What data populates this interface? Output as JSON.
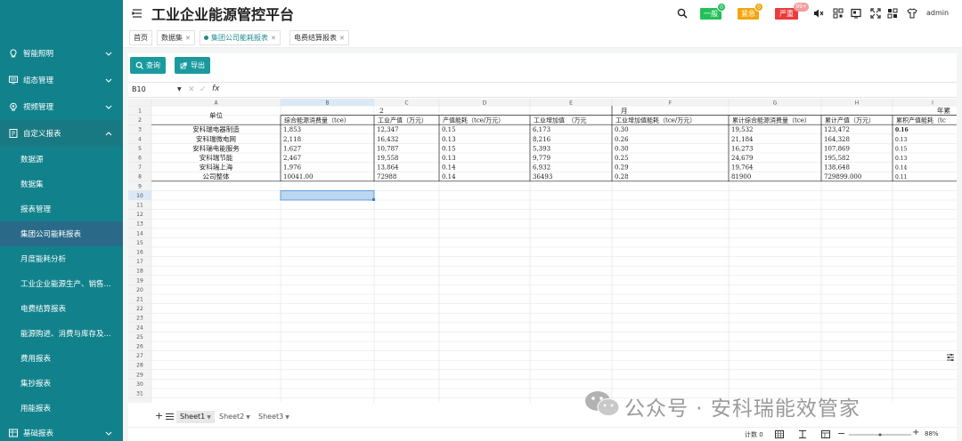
{
  "app": {
    "title": "工业企业能源管控平台",
    "user": "admin"
  },
  "header": {
    "tags": [
      {
        "label": "一般",
        "count": "0",
        "color": "#24c05a"
      },
      {
        "label": "紧急",
        "count": "0",
        "color": "#f2a60c"
      },
      {
        "label": "严重",
        "count": "99+",
        "color": "#ee3a3a"
      }
    ],
    "icons": [
      "search-icon",
      "mute-icon",
      "qrcode-icon",
      "screen-icon",
      "fullscreen-icon",
      "grid-icon",
      "shirt-icon"
    ]
  },
  "sidebar": {
    "items": [
      {
        "label": "智能照明",
        "icon": "bulb-icon",
        "chevron": "down"
      },
      {
        "label": "组态管理",
        "icon": "monitor-icon",
        "chevron": "down"
      },
      {
        "label": "视频管理",
        "icon": "camera-icon",
        "chevron": "down"
      },
      {
        "label": "自定义报表",
        "icon": "report-icon",
        "chevron": "up"
      }
    ],
    "subitems": [
      {
        "label": "数据源"
      },
      {
        "label": "数据集"
      },
      {
        "label": "报表管理"
      },
      {
        "label": "集团公司能耗报表",
        "active": true
      },
      {
        "label": "月度能耗分析"
      },
      {
        "label": "工业企业能源生产、销售..."
      },
      {
        "label": "电费结算报表"
      },
      {
        "label": "能源购进、消费与库存及..."
      },
      {
        "label": "费用报表"
      },
      {
        "label": "集抄报表"
      },
      {
        "label": "用能报表"
      }
    ],
    "footer": {
      "label": "基础报表",
      "icon": "table-icon",
      "chevron": "down"
    }
  },
  "tabs": [
    {
      "label": "首页",
      "closable": false
    },
    {
      "label": "数据集",
      "closable": true
    },
    {
      "label": "集团公司能耗报表",
      "closable": true,
      "active": true
    },
    {
      "label": "电费结算报表",
      "closable": true
    }
  ],
  "toolbar": {
    "query_label": "查询",
    "export_label": "导出"
  },
  "formula_bar": {
    "cell_ref": "B10",
    "cancel": "✕",
    "confirm": "✓",
    "fx": "fx"
  },
  "sheet": {
    "columns": [
      "A",
      "B",
      "C",
      "D",
      "E",
      "F",
      "G",
      "H",
      "I"
    ],
    "rows": [
      "1",
      "2",
      "3",
      "4",
      "5",
      "6",
      "7",
      "8",
      "9",
      "10",
      "11",
      "12",
      "13",
      "14",
      "15",
      "16",
      "17",
      "18",
      "19",
      "20",
      "21",
      "22",
      "23",
      "24",
      "25",
      "26",
      "27",
      "28",
      "29",
      "30",
      "31"
    ],
    "title_2": "2",
    "title_month": "月",
    "title_year": "年累",
    "unit_header": "单位",
    "headers": [
      "综合能源消费量（tce）",
      "工业产值（万元）",
      "产值能耗（tce/万元）",
      "工业增加值　（万元",
      "工业增加值能耗（tce/万元）",
      "累计综合能源消费量（tce）",
      "累计产值（万元）",
      "累积产值能耗（tc"
    ],
    "data": [
      [
        "安科瑞电器制造",
        "1,853",
        "12,347",
        "0.15",
        "6,173",
        "0.30",
        "19,532",
        "123,472",
        "0.16"
      ],
      [
        "安科瑞微电网",
        "2,118",
        "16,432",
        "0.13",
        "8,216",
        "0.26",
        "21,184",
        "164,328",
        "0.13"
      ],
      [
        "安科瑞电能服务",
        "1,627",
        "10,787",
        "0.15",
        "5,393",
        "0.30",
        "16,273",
        "107,869",
        "0.15"
      ],
      [
        "安科瑞节能",
        "2,467",
        "19,558",
        "0.13",
        "9,779",
        "0.25",
        "24,679",
        "195,582",
        "0.13"
      ],
      [
        "安科瑞上海",
        "1,976",
        "13,864",
        "0.14",
        "6,932",
        "0.29",
        "19,764",
        "138,648",
        "0.14"
      ],
      [
        "公司整体",
        "10041.00",
        "72988",
        "0.14",
        "36493",
        "0.28",
        "81900",
        "729899.000",
        "0.11"
      ]
    ]
  },
  "sheets": [
    "Sheet1",
    "Sheet2",
    "Sheet3"
  ],
  "status": {
    "count_label": "计数 0",
    "zoom": "88%"
  },
  "watermark": {
    "text": "公众号 · 安科瑞能效管家"
  },
  "colors": {
    "sidebar": "#11828c",
    "accent": "#1a9a9e",
    "selection": "#bcd7f2"
  }
}
